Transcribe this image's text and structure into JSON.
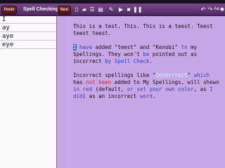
{
  "toolbar": {
    "finish_label": "Finish",
    "title": "Spell Checking",
    "next_label": "Next",
    "icons": [
      "document-icon",
      "folder-icon",
      "list-icon",
      "paste-icon",
      "format-icon",
      "play-icon",
      "stop-icon",
      "pause-icon",
      "undo-icon",
      "redo-icon",
      "text-size-icon",
      "settings-icon"
    ],
    "font_label": "Aa"
  },
  "sidebar": {
    "words": [
      "I",
      "ay",
      "aye",
      "eye"
    ]
  },
  "editor": {
    "p1": "This is a test. This. This is a teest. Teest teest teest.",
    "p2": {
      "s1": "I",
      "s2": " have",
      "s3": " added \"teest\" and \"Kenobi\" ",
      "s4": "to",
      "s5": " my Spellings.  They won't ",
      "s6": "be",
      "s7": " pointed out as incorrect ",
      "s8": "by Spell Check",
      "s9": "."
    },
    "p3": {
      "s1": "Incorrect spellings like \"",
      "s2": "Incorrrect",
      "s3": "\" ",
      "s4": "which",
      "s5": " has ",
      "s6": "not been",
      "s7": " added to My Spellings, will shown ",
      "s8": "in red",
      "s9": " (default, ",
      "s10": "or set your own color",
      "s11": ", as ",
      "s12": "I did",
      "s13": ") as an incorrect ",
      "s14": "word",
      "s15": "."
    }
  },
  "colors": {
    "accent": "#c9a6e6",
    "misspelled": "#d8261d",
    "link_blue": "#2444c8",
    "toolbar": "#5e3572"
  }
}
